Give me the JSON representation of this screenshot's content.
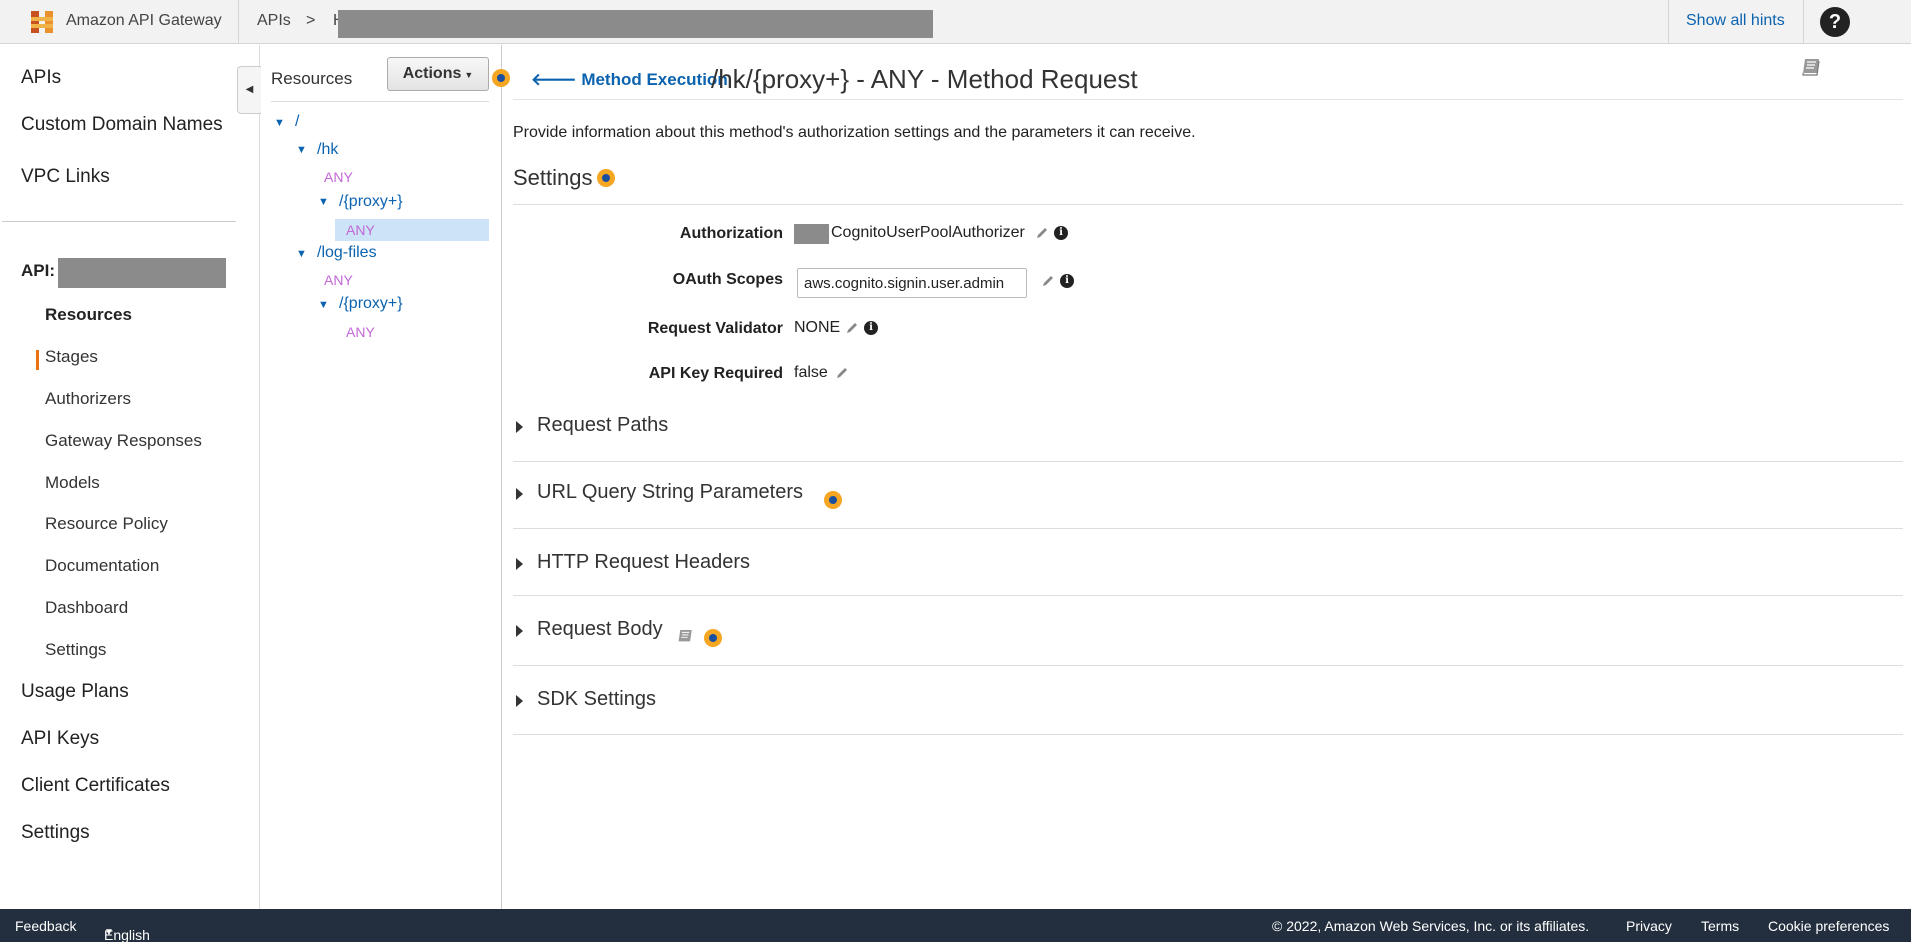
{
  "topbar": {
    "brand": "Amazon API Gateway",
    "breadcrumb_apis": "APIs",
    "breadcrumb_sep": ">",
    "breadcrumb_partial": "H",
    "show_hints": "Show all hints",
    "help": "?"
  },
  "leftnav": {
    "top_items": [
      "APIs",
      "Custom Domain Names",
      "VPC Links"
    ],
    "api_label": "API:",
    "sub_items": [
      "Resources",
      "Stages",
      "Authorizers",
      "Gateway Responses",
      "Models",
      "Resource Policy",
      "Documentation",
      "Dashboard",
      "Settings"
    ],
    "bottom_items": [
      "Usage Plans",
      "API Keys",
      "Client Certificates",
      "Settings"
    ]
  },
  "resources": {
    "title": "Resources",
    "actions": "Actions",
    "tree": {
      "root": "/",
      "hk": "/hk",
      "hk_any": "ANY",
      "hk_proxy": "/{proxy+}",
      "hk_proxy_any": "ANY",
      "log_files": "/log-files",
      "log_any": "ANY",
      "log_proxy": "/{proxy+}",
      "log_proxy_any": "ANY"
    }
  },
  "main": {
    "back_link": "Method Execution",
    "title": "/hk/{proxy+} - ANY - Method Request",
    "description": "Provide information about this method's authorization settings and the parameters it can receive.",
    "settings_heading": "Settings",
    "fields": {
      "authorization_label": "Authorization",
      "authorization_value": "CognitoUserPoolAuthorizer",
      "oauth_label": "OAuth Scopes",
      "oauth_value": "aws.cognito.signin.user.admin",
      "validator_label": "Request Validator",
      "validator_value": "NONE",
      "apikey_label": "API Key Required",
      "apikey_value": "false"
    },
    "sections": [
      "Request Paths",
      "URL Query String Parameters",
      "HTTP Request Headers",
      "Request Body",
      "SDK Settings"
    ]
  },
  "footer": {
    "feedback": "Feedback",
    "language": "English (US)",
    "copyright": "© 2022, Amazon Web Services, Inc. or its affiliates.",
    "privacy": "Privacy",
    "terms": "Terms",
    "cookies": "Cookie preferences"
  },
  "colors": {
    "link": "#0b63b0",
    "method": "#c267d6",
    "hint_orange": "#f5a623",
    "footer_bg": "#232f3e",
    "active_accent": "#ec7211"
  }
}
